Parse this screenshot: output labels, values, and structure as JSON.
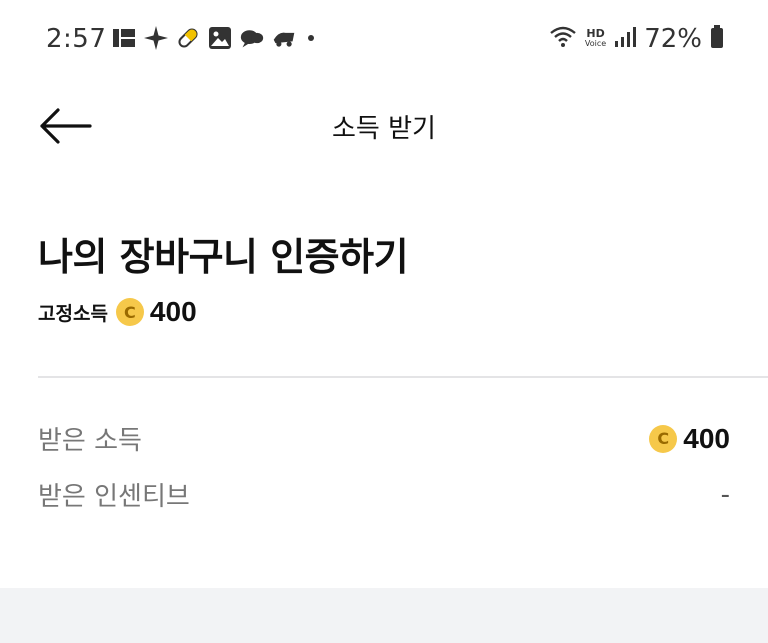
{
  "status_bar": {
    "time": "2:57",
    "hd_label": "HD",
    "voice_label": "Voice",
    "battery": "72%"
  },
  "nav": {
    "title": "소득 받기"
  },
  "mission": {
    "title": "나의 장바구니 인증하기",
    "fixed_income_label": "고정소득",
    "coin_symbol": "C",
    "fixed_income_amount": "400"
  },
  "details": {
    "received_income_label": "받은 소득",
    "received_income_amount": "400",
    "received_incentive_label": "받은 인센티브",
    "received_incentive_value": "-"
  },
  "colors": {
    "coin": "#f6c84a",
    "divider": "#e4e4e6",
    "bottom_band": "#f2f3f5"
  }
}
